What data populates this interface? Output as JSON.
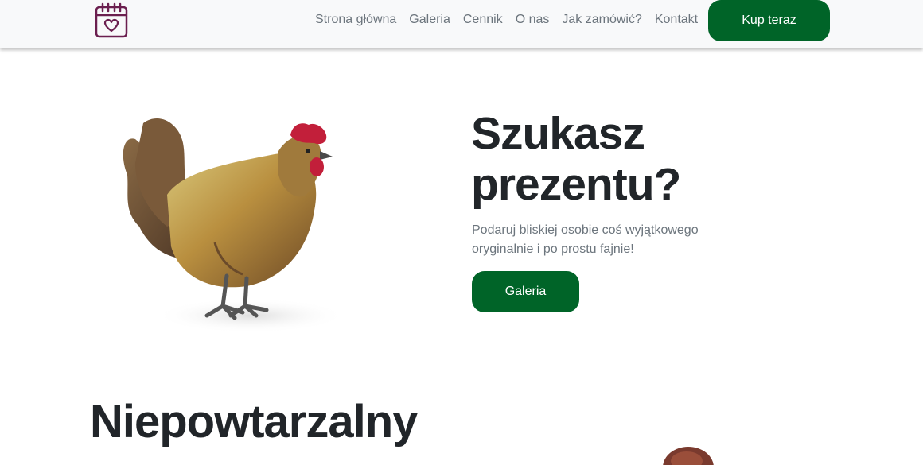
{
  "navbar": {
    "logo_icon": "calendar-heart-icon",
    "links": [
      {
        "label": "Strona główna"
      },
      {
        "label": "Galeria"
      },
      {
        "label": "Cennik"
      },
      {
        "label": "O nas"
      },
      {
        "label": "Jak zamówić?"
      },
      {
        "label": "Kontakt"
      }
    ],
    "cta_label": "Kup teraz"
  },
  "hero": {
    "image_icon": "rooster-image",
    "title": "Szukasz prezentu?",
    "text": "Podaruj bliskiej osobie coś wyjątkowego oryginalnie i po prostu fajnie!",
    "button_label": "Galeria"
  },
  "section2": {
    "title": "Niepowtarzalny",
    "title_continued": "",
    "image_icon": "hen-image"
  },
  "colors": {
    "accent": "#006428",
    "logo": "#6b1f4f",
    "nav_bg": "#f8f9fa",
    "muted_text": "#6c757d",
    "heading": "#212529"
  }
}
